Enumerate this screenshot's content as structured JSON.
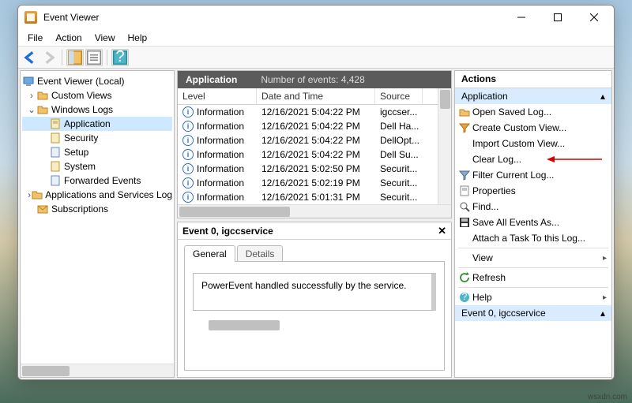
{
  "window": {
    "title": "Event Viewer"
  },
  "menu": {
    "file": "File",
    "action": "Action",
    "view": "View",
    "help": "Help"
  },
  "tree": {
    "root": "Event Viewer (Local)",
    "custom_views": "Custom Views",
    "windows_logs": "Windows Logs",
    "application": "Application",
    "security": "Security",
    "setup": "Setup",
    "system": "System",
    "forwarded": "Forwarded Events",
    "apps_services": "Applications and Services Log",
    "subscriptions": "Subscriptions"
  },
  "events_header": {
    "log_name": "Application",
    "count_label": "Number of events: 4,428"
  },
  "columns": {
    "level": "Level",
    "datetime": "Date and Time",
    "source": "Source"
  },
  "rows": [
    {
      "level": "Information",
      "datetime": "12/16/2021 5:04:22 PM",
      "source": "igccser..."
    },
    {
      "level": "Information",
      "datetime": "12/16/2021 5:04:22 PM",
      "source": "Dell Ha..."
    },
    {
      "level": "Information",
      "datetime": "12/16/2021 5:04:22 PM",
      "source": "DellOpt..."
    },
    {
      "level": "Information",
      "datetime": "12/16/2021 5:04:22 PM",
      "source": "Dell Su..."
    },
    {
      "level": "Information",
      "datetime": "12/16/2021 5:02:50 PM",
      "source": "Securit..."
    },
    {
      "level": "Information",
      "datetime": "12/16/2021 5:02:19 PM",
      "source": "Securit..."
    },
    {
      "level": "Information",
      "datetime": "12/16/2021 5:01:31 PM",
      "source": "Securit..."
    }
  ],
  "detail": {
    "title": "Event 0, igccservice",
    "tab_general": "General",
    "tab_details": "Details",
    "message": "PowerEvent handled successfully by the service."
  },
  "actions": {
    "header": "Actions",
    "section1": "Application",
    "open_saved": "Open Saved Log...",
    "create_view": "Create Custom View...",
    "import_view": "Import Custom View...",
    "clear_log": "Clear Log...",
    "filter_log": "Filter Current Log...",
    "properties": "Properties",
    "find": "Find...",
    "save_all": "Save All Events As...",
    "attach_task": "Attach a Task To this Log...",
    "view": "View",
    "refresh": "Refresh",
    "help": "Help",
    "section2": "Event 0, igccservice"
  },
  "watermark": "wsxdn.com"
}
